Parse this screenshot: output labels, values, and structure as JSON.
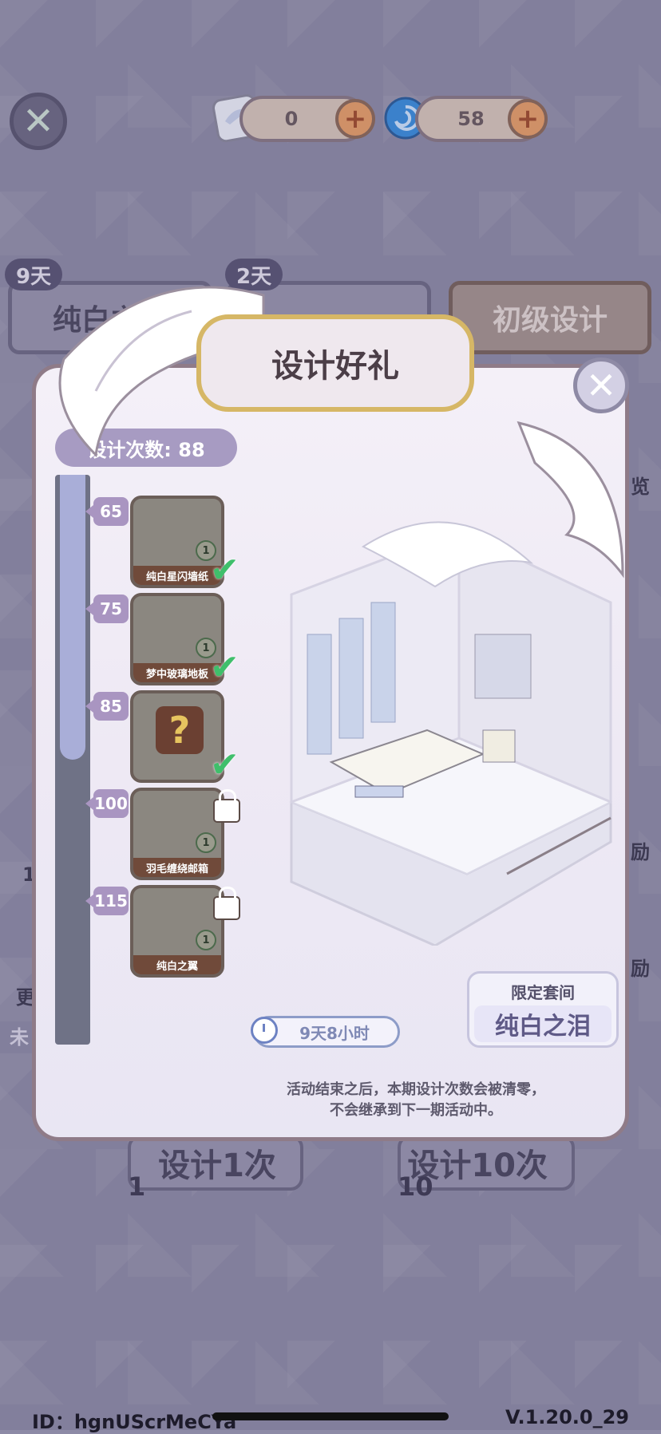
{
  "top_bar": {
    "currency1_value": "0",
    "currency2_value": "58"
  },
  "background": {
    "tab_left_days": "9天",
    "tab_left_label": "纯白之泪",
    "tab_mid_days": "2天",
    "tab_right_label": "初级设计",
    "design_once": "设计1次",
    "design_once_count": "1",
    "design_ten": "设计10次",
    "design_ten_count": "10",
    "side_text_1": "览",
    "side_text_2": "励",
    "side_text_3": "励",
    "side_text_4": "更",
    "side_text_5": "未",
    "side_text_6": "1"
  },
  "modal": {
    "title": "设计好礼",
    "design_count_label": "设计次数: 88",
    "progress_fraction": 0.5,
    "rewards": [
      {
        "milestone": "65",
        "label": "纯白星闪墙纸",
        "qty": "1",
        "state": "claimed"
      },
      {
        "milestone": "75",
        "label": "梦中玻璃地板",
        "qty": "1",
        "state": "claimed"
      },
      {
        "milestone": "85",
        "label": "",
        "qty": "",
        "state": "claimed"
      },
      {
        "milestone": "100",
        "label": "羽毛缠绕邮箱",
        "qty": "1",
        "state": "locked"
      },
      {
        "milestone": "115",
        "label": "纯白之翼",
        "qty": "1",
        "state": "locked"
      }
    ],
    "timer": "9天8小时",
    "suite_title": "限定套间",
    "suite_name": "纯白之泪",
    "note_line1": "活动结束之后，本期设计次数会被清零，",
    "note_line2": "不会继承到下一期活动中。"
  },
  "footer": {
    "id": "ID：hgnUScrMeCYa",
    "version": "V.1.20.0_29"
  },
  "colors": {
    "accent_gold": "#d6b766",
    "check_green": "#3fbf6b",
    "milestone_purple": "#a995c1"
  }
}
